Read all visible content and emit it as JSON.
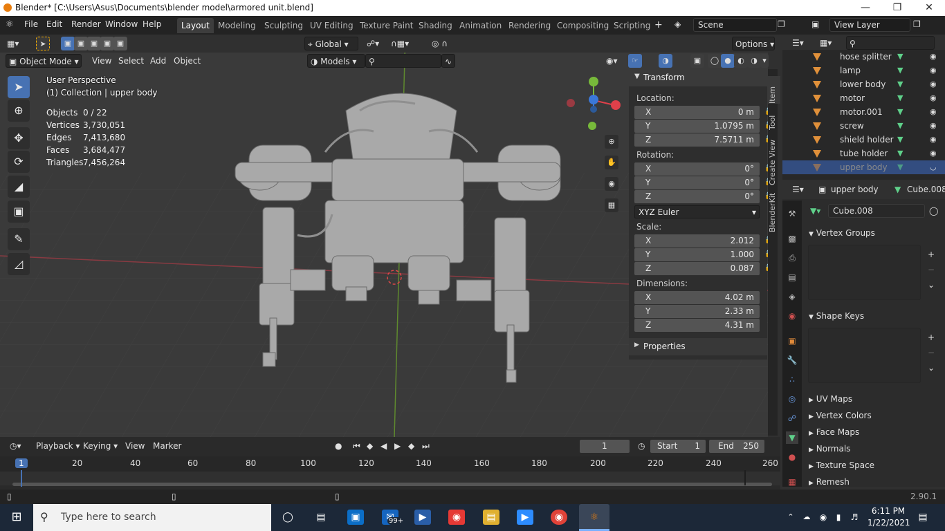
{
  "window": {
    "title": "Blender* [C:\\Users\\Asus\\Documents\\blender model\\armored unit.blend]"
  },
  "menus": [
    "File",
    "Edit",
    "Render",
    "Window",
    "Help"
  ],
  "workspaces": [
    {
      "label": "Layout",
      "active": true
    },
    {
      "label": "Modeling"
    },
    {
      "label": "Sculpting"
    },
    {
      "label": "UV Editing"
    },
    {
      "label": "Texture Paint"
    },
    {
      "label": "Shading"
    },
    {
      "label": "Animation"
    },
    {
      "label": "Rendering"
    },
    {
      "label": "Compositing"
    },
    {
      "label": "Scripting"
    }
  ],
  "scene": {
    "label": "Scene"
  },
  "view_layer": {
    "label": "View Layer"
  },
  "viewport_header": {
    "transform_orientation": "Global",
    "options": "Options",
    "mode": "Object Mode",
    "menus": [
      "View",
      "Select",
      "Add",
      "Object"
    ],
    "collection_filter": "Models"
  },
  "overlay_text": {
    "perspective": "User Perspective",
    "collection": "(1) Collection | upper body"
  },
  "stats": [
    {
      "label": "Objects",
      "value": "0 / 22"
    },
    {
      "label": "Vertices",
      "value": "3,730,051"
    },
    {
      "label": "Edges",
      "value": "7,413,680"
    },
    {
      "label": "Faces",
      "value": "3,684,477"
    },
    {
      "label": "Triangles",
      "value": "7,456,264"
    }
  ],
  "npanel": {
    "header": "Transform",
    "location_label": "Location:",
    "location": [
      {
        "axis": "X",
        "value": "0 m"
      },
      {
        "axis": "Y",
        "value": "1.0795 m"
      },
      {
        "axis": "Z",
        "value": "7.5711 m"
      }
    ],
    "rotation_label": "Rotation:",
    "rotation": [
      {
        "axis": "X",
        "value": "0°"
      },
      {
        "axis": "Y",
        "value": "0°"
      },
      {
        "axis": "Z",
        "value": "0°"
      }
    ],
    "rotation_mode": "XYZ Euler",
    "scale_label": "Scale:",
    "scale": [
      {
        "axis": "X",
        "value": "2.012"
      },
      {
        "axis": "Y",
        "value": "1.000"
      },
      {
        "axis": "Z",
        "value": "0.087"
      }
    ],
    "dimensions_label": "Dimensions:",
    "dimensions": [
      {
        "axis": "X",
        "value": "4.02 m"
      },
      {
        "axis": "Y",
        "value": "2.33 m"
      },
      {
        "axis": "Z",
        "value": "4.31 m"
      }
    ],
    "properties": "Properties",
    "tabs": [
      "Item",
      "Tool",
      "View",
      "Create",
      "BlenderKit"
    ]
  },
  "outliner": {
    "items": [
      "hose splitter",
      "lamp",
      "lower body",
      "motor",
      "motor.001",
      "screw",
      "shield holder",
      "tube holder",
      "upper body"
    ],
    "selected": "upper body"
  },
  "properties": {
    "object": "upper body",
    "data": "Cube.008",
    "mesh_name": "Cube.008",
    "sections": [
      "Vertex Groups",
      "Shape Keys",
      "UV Maps",
      "Vertex Colors",
      "Face Maps",
      "Normals",
      "Texture Space",
      "Remesh"
    ]
  },
  "timeline": {
    "menus": [
      "Playback",
      "Keying",
      "View",
      "Marker"
    ],
    "current_frame": "1",
    "start_label": "Start",
    "start": "1",
    "end_label": "End",
    "end": "250",
    "ticks": [
      "1",
      "20",
      "40",
      "60",
      "80",
      "100",
      "120",
      "140",
      "160",
      "180",
      "200",
      "220",
      "240",
      "260"
    ]
  },
  "statusbar": {
    "version": "2.90.1"
  },
  "taskbar": {
    "search_placeholder": "Type here to search",
    "time": "6:11 PM",
    "date": "1/22/2021",
    "mail_badge": "99+"
  },
  "colors": {
    "accent": "#4772b3",
    "x_axis": "#e0404a",
    "y_axis": "#77b93a",
    "z_axis": "#3b78d8",
    "object_orange": "#e0903a"
  }
}
